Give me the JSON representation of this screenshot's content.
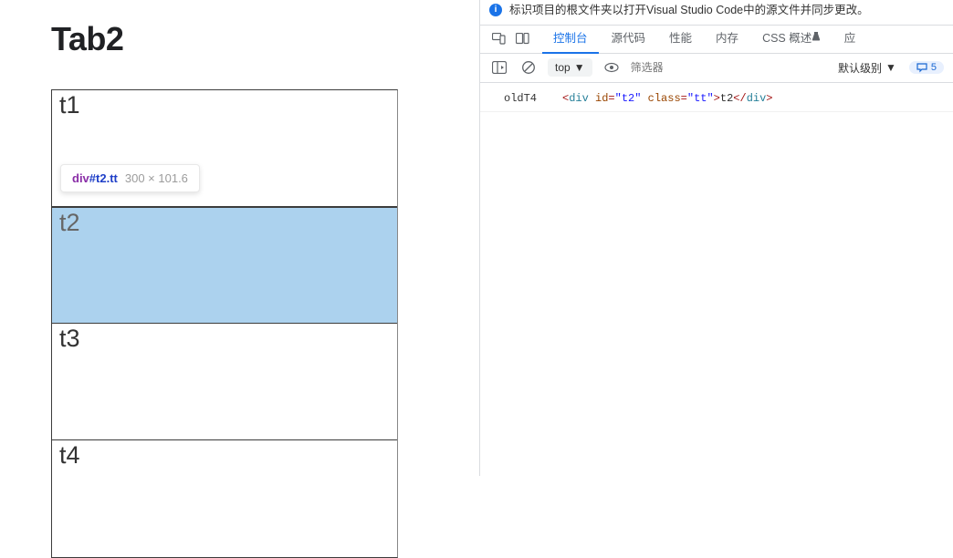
{
  "leftPage": {
    "heading": "Tab2",
    "cells": [
      "t1",
      "t2",
      "t3",
      "t4"
    ],
    "selectedIndex": 1
  },
  "inspectTooltip": {
    "tag": "div",
    "id": "#t2",
    "cls": ".tt",
    "dims": "300 × 101.6"
  },
  "devtools": {
    "infoMessage": "标识项目的根文件夹以打开Visual Studio Code中的源文件并同步更改。",
    "tabs": {
      "console": "控制台",
      "sources": "源代码",
      "perf": "性能",
      "memory": "内存",
      "cssOverview": "CSS 概述",
      "app": "应"
    },
    "consoleBar": {
      "context": "top",
      "filterPlaceholder": "筛选器",
      "levelLabel": "默认级别",
      "messageCount": "5"
    },
    "consoleOutput": {
      "label": "oldT4",
      "elementTag": "div",
      "elementId": "t2",
      "elementClass": "tt",
      "elementText": "t2"
    }
  }
}
